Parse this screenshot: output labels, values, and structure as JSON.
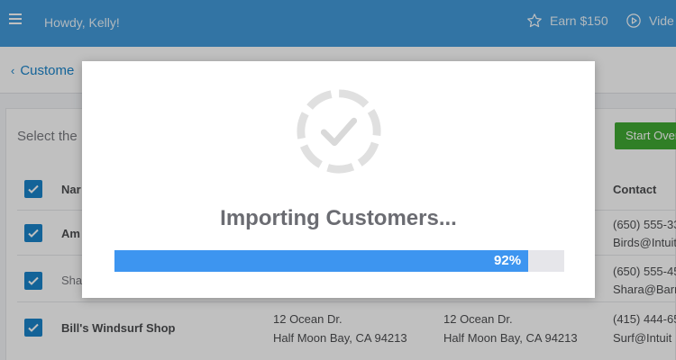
{
  "topbar": {
    "menu_icon": "hamburger-icon",
    "greeting": "Howdy, Kelly!",
    "earn_label": "Earn $150",
    "earn_icon": "star-icon",
    "videos_label": "Vide",
    "videos_icon": "play-circle-icon"
  },
  "breadcrumb": {
    "back_label": "Custome"
  },
  "card": {
    "select_text": "Select the",
    "start_over_label": "Start Over",
    "headers": {
      "name": "Nar",
      "contact": "Contact"
    },
    "rows": [
      {
        "name": "Am",
        "contact_lines": [
          "(650) 555-33",
          "Birds@Intuit"
        ]
      },
      {
        "name": "Shar",
        "contact_lines": [
          "(650) 555-45",
          "Shara@Barn"
        ]
      },
      {
        "name": "Bill's Windsurf Shop",
        "billing_lines": [
          "12 Ocean Dr.",
          "Half Moon Bay, CA 94213"
        ],
        "shipping_lines": [
          "12 Ocean Dr.",
          "Half Moon Bay, CA 94213"
        ],
        "contact_lines": [
          "(415) 444-65",
          "Surf@Intuit"
        ]
      }
    ]
  },
  "modal": {
    "status_icon": "circular-check-icon",
    "title": "Importing Customers...",
    "progress": {
      "percent": 92,
      "label": "92%"
    }
  },
  "colors": {
    "topbar": "#2f8fd6",
    "progress_fill": "#3d95f0",
    "checkbox": "#0077c5",
    "start_over": "#2ca01c"
  }
}
